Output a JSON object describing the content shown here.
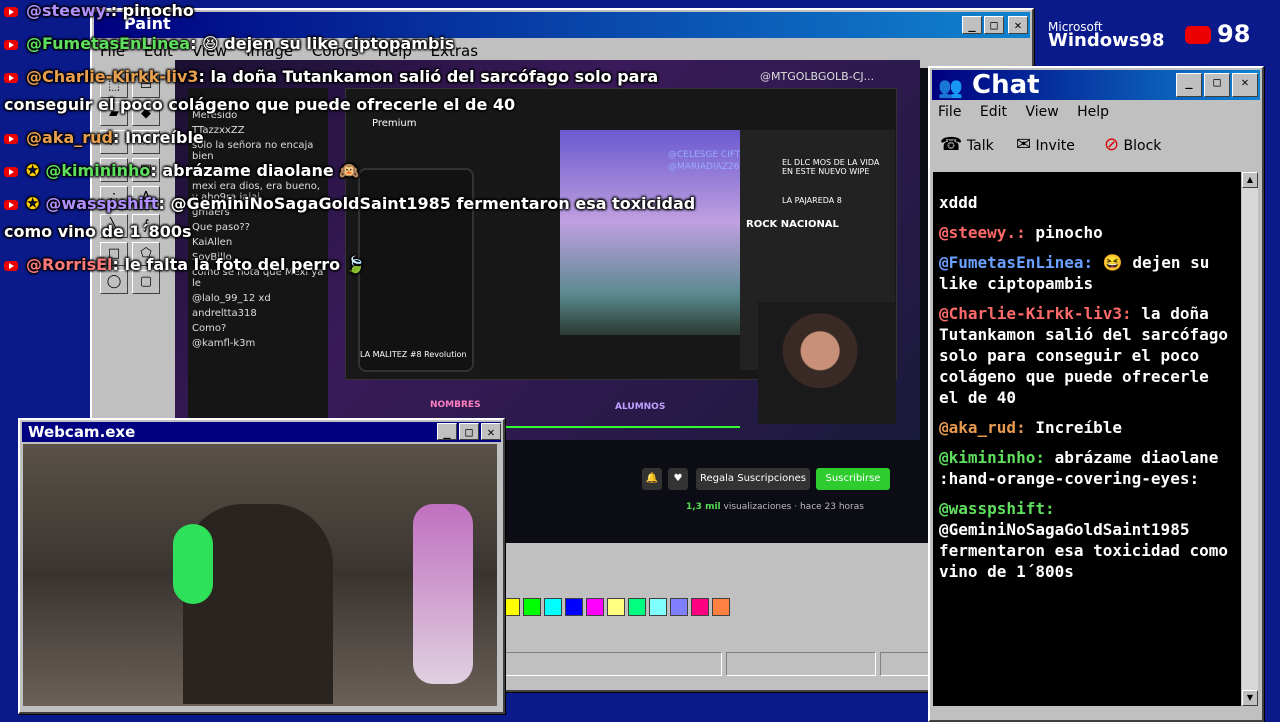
{
  "paint": {
    "title": "Paint",
    "menu": [
      "File",
      "Edit",
      "View",
      "Image",
      "Colors",
      "Help",
      "Extras"
    ],
    "palette": [
      "#ffff00",
      "#00ff00",
      "#00ffff",
      "#0000ff",
      "#ff00ff",
      "#ffff80",
      "#00ff80",
      "#80ffff",
      "#8080ff",
      "#ff0080",
      "#ff8040"
    ]
  },
  "stream": {
    "watermark": "@MTGOLBGOLB-CJ...",
    "video_title": "LA MALITEZ #8 Revolution",
    "chat_lines": [
      "Meresido",
      "TTazzxxZZ",
      "solo la señora no encaja bien",
      "ChamiKing",
      "mexi era dios, era bueno, y aho9ra jajaj",
      "gmaers",
      "Que paso??",
      "KaiAllen",
      "SoyBillo",
      "como se nota que Mexi ya le",
      "@lalo_99_12 xd",
      "andreltta318",
      "Como?",
      "@kamfl-k3m"
    ],
    "side_labels": [
      "EL DLC MOS DE LA VIDA EN ESTE NUEVO WIPE",
      "LA PAJAREDA 8",
      "ROCK NACIONAL"
    ],
    "role_badges": [
      "NOMBRES",
      "ALUMNOS"
    ],
    "gift_label": "Regala Suscripciones",
    "subscribe_label": "Suscribirse",
    "views": "1,3 mil",
    "views_suffix": "visualizaciones",
    "age": "hace 23 horas",
    "yt_premium": "Premium",
    "mentions": [
      "@CELESGE CIFTEO XI",
      "@MARIADIAZ2636"
    ]
  },
  "overlay_chat": [
    {
      "user": "@steewy.",
      "text": ": pinocho",
      "cls": "ovl-user-b"
    },
    {
      "user": "@FumetasEnLinea",
      "text": ": 😆 dejen su like ciptopambis",
      "cls": "ovl-user-g"
    },
    {
      "user": "@Charlie-Kirkk-liv3",
      "text": ": la doña Tutankamon salió del sarcófago solo para",
      "cls": "ovl-user-o"
    },
    {
      "user": "",
      "text": "conseguir el poco colágeno que puede ofrecerle el de 40",
      "cls": ""
    },
    {
      "user": "@aka_rud",
      "text": ": Increíble",
      "cls": "ovl-user-o"
    },
    {
      "user": "@kimininho",
      "text": ": abrázame diaolane 🙉",
      "cls": "ovl-user-g"
    },
    {
      "user": "@wasspshift",
      "text": ": @GeminiNoSagaGoldSaint1985 fermentaron esa toxicidad",
      "cls": "ovl-user-b"
    },
    {
      "user": "",
      "text": "como vino de 1´800s",
      "cls": ""
    },
    {
      "user": "@RorrisEl",
      "text": ": le falta la foto del perro 🍃",
      "cls": "ovl-user-p"
    }
  ],
  "brand": {
    "microsoft": "Microsoft",
    "windows": "Windows98",
    "yt_number": "98"
  },
  "chat": {
    "title": "Chat",
    "menu": [
      "File",
      "Edit",
      "View",
      "Help"
    ],
    "tools": [
      "Talk",
      "Invite",
      "Block"
    ],
    "messages": [
      {
        "user": "",
        "text": "xddd",
        "color": "u-white"
      },
      {
        "user": "@steewy.:",
        "text": " pinocho",
        "color": "u-red"
      },
      {
        "user": "@FumetasEnLinea:",
        "text": " 😆 dejen su like ciptopambis",
        "color": "u-blue"
      },
      {
        "user": "@Charlie-Kirkk-liv3:",
        "text": " la doña Tutankamon salió del sarcófago solo para conseguir el poco colágeno que puede ofrecerle el de 40",
        "color": "u-red"
      },
      {
        "user": "@aka_rud:",
        "text": " Increíble",
        "color": "u-orange"
      },
      {
        "user": "@kimininho:",
        "text": " abrázame diaolane :hand-orange-covering-eyes:",
        "color": "u-green"
      },
      {
        "user": "@wasspshift:",
        "text": " @GeminiNoSagaGoldSaint1985 fermentaron esa toxicidad como vino de 1´800s",
        "color": "u-green"
      }
    ]
  },
  "webcam": {
    "title": "Webcam.exe"
  }
}
